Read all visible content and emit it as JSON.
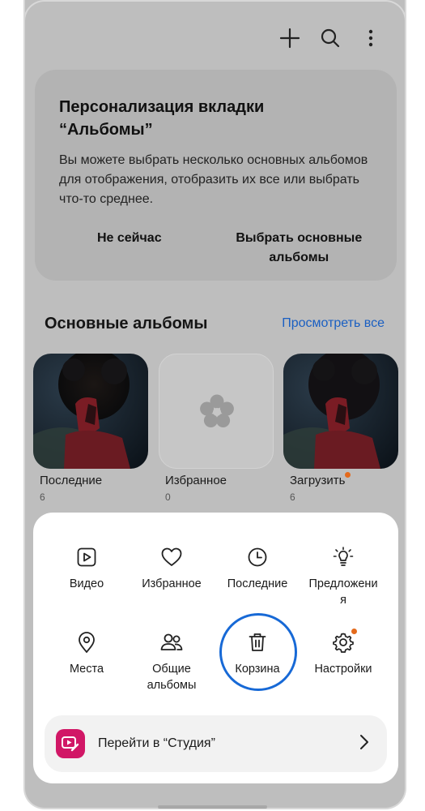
{
  "topbar": {
    "icons": [
      "plus-icon",
      "search-icon",
      "more-vertical-icon"
    ]
  },
  "promo": {
    "title_line1": "Персонализация вкладки",
    "title_line2": "“Альбомы”",
    "text": "Вы можете выбрать несколько основных альбомов для отображения, отобразить их все или выбрать что-то среднее.",
    "dismiss_label": "Не сейчас",
    "choose_label_line1": "Выбрать основные",
    "choose_label_line2": "альбомы"
  },
  "section": {
    "title": "Основные альбомы",
    "view_all": "Просмотреть все"
  },
  "albums": [
    {
      "name": "Последние",
      "count": "6",
      "thumb": "photo"
    },
    {
      "name": "Избранное",
      "count": "0",
      "thumb": "empty-flower"
    },
    {
      "name": "Загрузить",
      "count": "6",
      "thumb": "photo",
      "badge": true
    }
  ],
  "menu": {
    "row1": [
      {
        "label": "Видео",
        "icon": "video-icon"
      },
      {
        "label": "Избранное",
        "icon": "heart-icon"
      },
      {
        "label": "Последние",
        "icon": "clock-icon"
      },
      {
        "label_line1": "Предложени",
        "label_line2": "я",
        "icon": "lightbulb-icon"
      }
    ],
    "row2": [
      {
        "label": "Места",
        "icon": "location-pin-icon"
      },
      {
        "label_line1": "Общие",
        "label_line2": "альбомы",
        "icon": "people-icon"
      },
      {
        "label": "Корзина",
        "icon": "trash-icon",
        "highlighted": true
      },
      {
        "label": "Настройки",
        "icon": "gear-icon",
        "badge": true
      }
    ]
  },
  "studio": {
    "label": "Перейти в “Студия”"
  },
  "colors": {
    "accent_link": "#1a5fc2",
    "highlight_ring": "#1769d6",
    "badge_dot": "#e46a1c",
    "studio_icon": "#d11766"
  }
}
